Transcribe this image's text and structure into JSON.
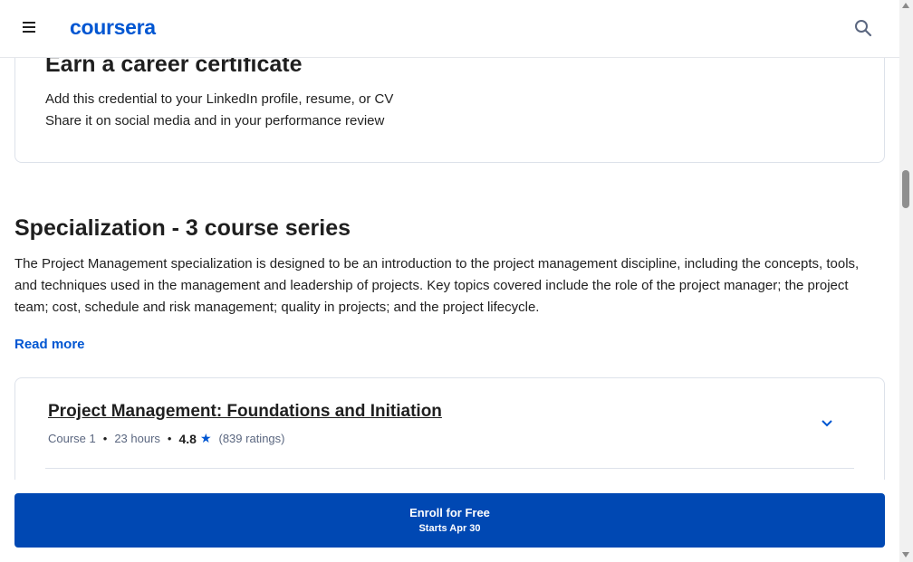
{
  "header": {
    "logo_text": "coursera",
    "menu_icon": "hamburger-menu-icon",
    "search_icon": "search-icon",
    "brand_color": "#0056d2"
  },
  "certificate": {
    "title": "Earn a career certificate",
    "lines": [
      "Add this credential to your LinkedIn profile, resume, or CV",
      "Share it on social media and in your performance review"
    ]
  },
  "specialization": {
    "title": "Specialization - 3 course series",
    "description": "The Project Management specialization is designed to be an introduction to the project management discipline, including the concepts, tools, and techniques used in the management and leadership of projects. Key topics covered include the role of the project manager; the project team; cost, schedule and risk management; quality in projects; and the project lifecycle.",
    "read_more": "Read more"
  },
  "course": {
    "title": "Project Management: Foundations and Initiation",
    "number": "Course 1",
    "hours": "23 hours",
    "rating": "4.8",
    "ratings_count": "(839 ratings)",
    "expand_icon": "chevron-down-icon"
  },
  "enroll": {
    "label": "Enroll for Free",
    "sublabel": "Starts Apr 30",
    "color": "#0048b3"
  }
}
